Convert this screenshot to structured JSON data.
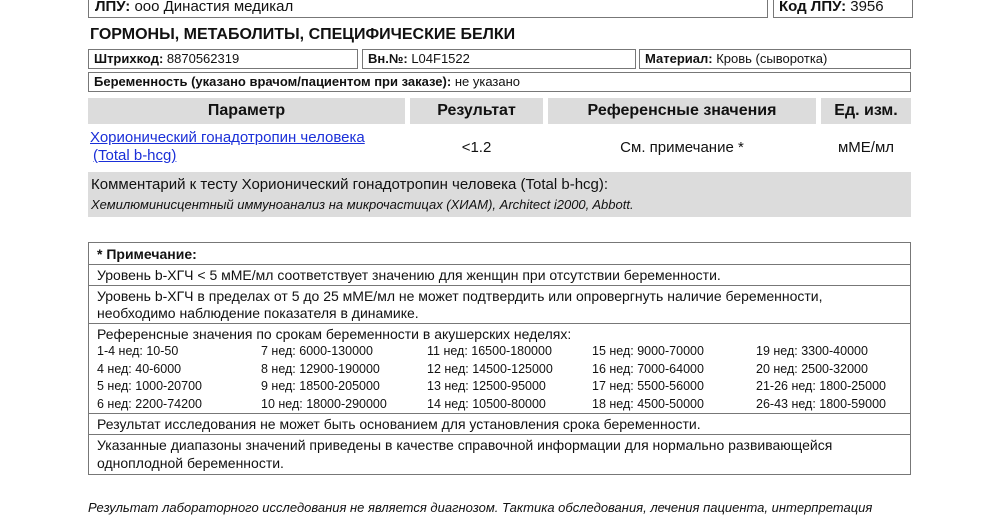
{
  "header": {
    "lpu_label": "ЛПУ:",
    "lpu_value": "ооо Династия медикал",
    "code_label": "Код ЛПУ:",
    "code_value": "3956"
  },
  "section_title": "ГОРМОНЫ, МЕТАБОЛИТЫ, СПЕЦИФИЧЕСКИЕ БЕЛКИ",
  "info": {
    "barcode_label": "Штрихкод:",
    "barcode_value": "8870562319",
    "internal_label": "Вн.№:",
    "internal_value": "L04F1522",
    "material_label": "Материал:",
    "material_value": "Кровь (сыворотка)",
    "pregnancy_label": "Беременность (указано врачом/пациентом при заказе):",
    "pregnancy_value": "не указано"
  },
  "table": {
    "headers": [
      "Параметр",
      "Результат",
      "Референсные значения",
      "Ед. изм."
    ],
    "row": {
      "param_line1": "Хорионический гонадотропин человека",
      "param_line2": "(Total b-hcg)",
      "result": "<1.2",
      "reference": "См. примечание *",
      "unit": "мМЕ/мл"
    }
  },
  "comment": {
    "title": "Комментарий к тесту Хорионический гонадотропин человека (Total b-hcg):",
    "method": "Хемилюминисцентный иммуноанализ на микрочастицах (ХИАМ), Architect i2000, Abbott."
  },
  "note": {
    "title": "* Примечание:",
    "line1": "Уровень b-ХГЧ < 5 мМЕ/мл соответствует значению для женщин при отсутствии беременности.",
    "line2a": "Уровень b-ХГЧ в пределах от 5 до 25 мМЕ/мл не может подтвердить или опровергнуть наличие беременности,",
    "line2b": "необходимо наблюдение показателя в динамике.",
    "ref_title": "Референсные значения по срокам беременности в акушерских неделях:",
    "ref_grid": [
      [
        "1-4 нед: 10-50",
        "7 нед: 6000-130000",
        "11 нед: 16500-180000",
        "15 нед: 9000-70000",
        "19 нед: 3300-40000"
      ],
      [
        "4 нед: 40-6000",
        "8 нед: 12900-190000",
        "12 нед: 14500-125000",
        "16 нед: 7000-64000",
        "20 нед: 2500-32000"
      ],
      [
        "5 нед: 1000-20700",
        "9 нед: 18500-205000",
        "13 нед: 12500-95000",
        "17 нед: 5500-56000",
        "21-26 нед: 1800-25000"
      ],
      [
        "6 нед: 2200-74200",
        "10 нед: 18000-290000",
        "14 нед: 10500-80000",
        "18 нед: 4500-50000",
        "26-43 нед: 1800-59000"
      ]
    ],
    "line3": "Результат исследования не может быть основанием для установления срока беременности.",
    "line4a": "Указанные диапазоны значений приведены в качестве справочной информации для нормально развивающейся",
    "line4b": "одноплодной беременности."
  },
  "footer": "Результат лабораторного исследования не является диагнозом. Тактика обследования, лечения пациента, интерпретация"
}
